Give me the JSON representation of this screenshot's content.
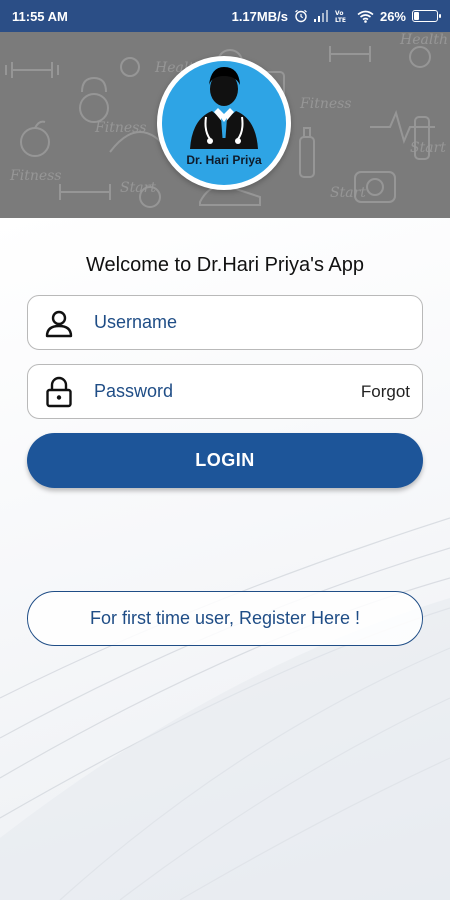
{
  "status_bar": {
    "time": "11:55 AM",
    "network_speed": "1.17MB/s",
    "battery_percent": "26%",
    "battery_level": 0.26,
    "icons": [
      "alarm-icon",
      "signal-icon",
      "volte-icon",
      "wifi-icon",
      "battery-icon"
    ]
  },
  "header": {
    "logo_label": "Dr. Hari Priya",
    "logo_icon": "doctor-icon"
  },
  "main": {
    "welcome": "Welcome to Dr.Hari Priya's App",
    "username": {
      "placeholder": "Username",
      "value": "",
      "icon": "user-icon"
    },
    "password": {
      "placeholder": "Password",
      "value": "",
      "icon": "lock-icon",
      "forgot_label": "Forgot"
    },
    "login_label": "LOGIN",
    "register_label": "For first time user, Register Here !"
  },
  "colors": {
    "status_bar": "#2b4e86",
    "header_bg": "#7b7b7b",
    "logo_blue": "#2ea4e5",
    "primary": "#1d5599",
    "text_blue": "#1f4d86"
  }
}
